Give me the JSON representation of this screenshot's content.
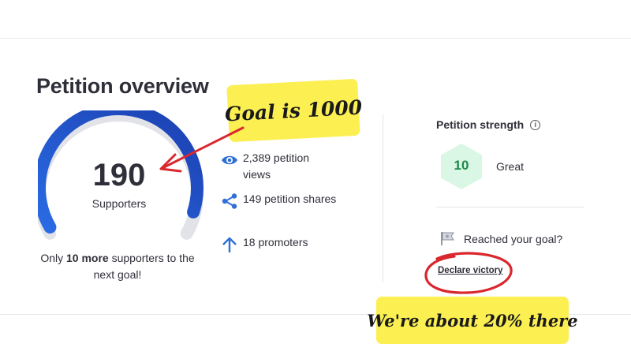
{
  "overview": {
    "title": "Petition overview",
    "supporters_count": "190",
    "supporters_label": "Supporters",
    "progress_fraction": 0.95,
    "next_goal_prefix": "Only ",
    "next_goal_bold": "10 more",
    "next_goal_suffix": " supporters to the next goal!"
  },
  "stats": [
    {
      "icon": "eye-icon",
      "text": "2,389 petition views"
    },
    {
      "icon": "share-icon",
      "text": "149 petition shares"
    },
    {
      "icon": "arrow-up-icon",
      "text": "18 promoters"
    }
  ],
  "strength": {
    "title": "Petition strength",
    "info_icon": "i",
    "score": "10",
    "label": "Great"
  },
  "goal": {
    "question": "Reached your goal?",
    "link": "Declare victory"
  },
  "annotations": {
    "goal_note": "Goal is 1000",
    "percent_note": "We're about 20% there"
  },
  "colors": {
    "gauge_start": "#2a6be3",
    "gauge_end": "#1b3fb0",
    "gauge_track": "#e2e3e8",
    "hex_fill": "#d9f7e4",
    "hex_text": "#1f8a4c",
    "icon_blue": "#2e6fd8",
    "note_yellow": "#fbef52",
    "annotation_red": "#d9272e"
  }
}
